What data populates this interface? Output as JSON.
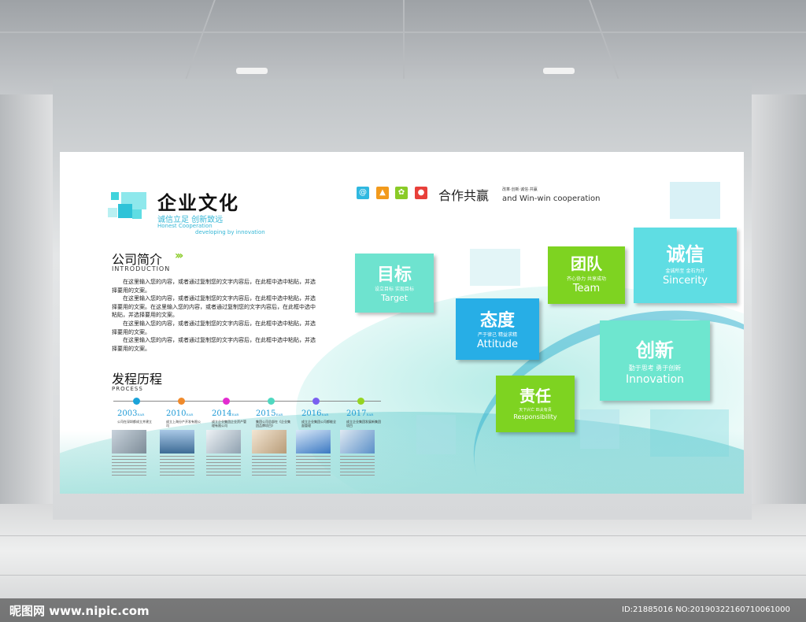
{
  "title": "企业文化",
  "subtitle_cn": "诚信立足 创新致远",
  "subtitle_en1": "Honest Cooperation",
  "subtitle_en2": "developing by innovation",
  "intro": {
    "heading": "公司简介",
    "arrows": "›››",
    "heading_en": "INTRODUCTION",
    "paragraphs": [
      "在这里输入您的内容，或者通过复制您的文字内容后，在此框中选中粘贴，并选择要用的文案。",
      "在这里输入您的内容，或者通过复制您的文字内容后，在此框中选中粘贴，并选择要用的文案。在这里输入您的内容，或者通过复制您的文字内容后，在此框中选中粘贴，并选择要用的文案。",
      "在这里输入您的内容，或者通过复制您的文字内容后，在此框中选中粘贴，并选择要用的文案。",
      "在这里输入您的内容，或者通过复制您的文字内容后，在此框中选中粘贴，并选择要用的文案。"
    ]
  },
  "process": {
    "heading": "发程历程",
    "heading_en": "PROCESS",
    "items": [
      {
        "year": "2003",
        "sub": "EAR",
        "text": "公司在深圳都成立并建立",
        "color": "#1aa3d9"
      },
      {
        "year": "2010",
        "sub": "EAR",
        "text": "成立上海分产开发有限公司",
        "color": "#f08a2b"
      },
      {
        "year": "2014",
        "sub": "EAR",
        "text": "成立企业集团企业资产管理有限公司",
        "color": "#e32bd0"
      },
      {
        "year": "2015",
        "sub": "EAR",
        "text": "集团公司总部在《企业集团品牌项目》",
        "color": "#4fd8c0"
      },
      {
        "year": "2016",
        "sub": "EAR",
        "text": "成立企业集团公司都能全面管理",
        "color": "#7a5ff0"
      },
      {
        "year": "2017",
        "sub": "EAR",
        "text": "成立企业集团发展新集团项目",
        "color": "#95d421"
      }
    ]
  },
  "coop": {
    "title": "合作共赢",
    "small": "改革·创新·诚信·共赢",
    "en": "and Win-win  cooperation",
    "icons": [
      {
        "name": "at-icon",
        "glyph": "@",
        "color": "#2fb8e0"
      },
      {
        "name": "chart-icon",
        "glyph": "▲",
        "color": "#f29a1c"
      },
      {
        "name": "gear-icon",
        "glyph": "✿",
        "color": "#8acb27"
      },
      {
        "name": "user-icon",
        "glyph": "●",
        "color": "#e8403a"
      }
    ]
  },
  "values": [
    {
      "key": "target",
      "title": "目标",
      "sub": "设立目标  实现目标",
      "en": "Target",
      "color": "#6ee3cf"
    },
    {
      "key": "team",
      "title": "团队",
      "sub": "齐心协力  共享成功",
      "en": "Team",
      "color": "#7ed321"
    },
    {
      "key": "sincerity",
      "title": "诚信",
      "sub": "金诚所至  金石为开",
      "en": "Sincerity",
      "color": "#5fdde3"
    },
    {
      "key": "attitude",
      "title": "态度",
      "sub": "严于律己  精益求精",
      "en": "Attitude",
      "color": "#27aee6"
    },
    {
      "key": "innovation",
      "title": "创新",
      "sub": "勤于思考  勇于创新",
      "en": "Innovation",
      "color": "#6ee6cf"
    },
    {
      "key": "responsibility",
      "title": "责任",
      "sub": "天下兴亡  匹夫有责",
      "en": "Responsibility",
      "color": "#7ed321"
    }
  ],
  "watermark": "昵图网 www.nipic.com",
  "image_id": "ID:21885016 NO:20190322160710061000"
}
